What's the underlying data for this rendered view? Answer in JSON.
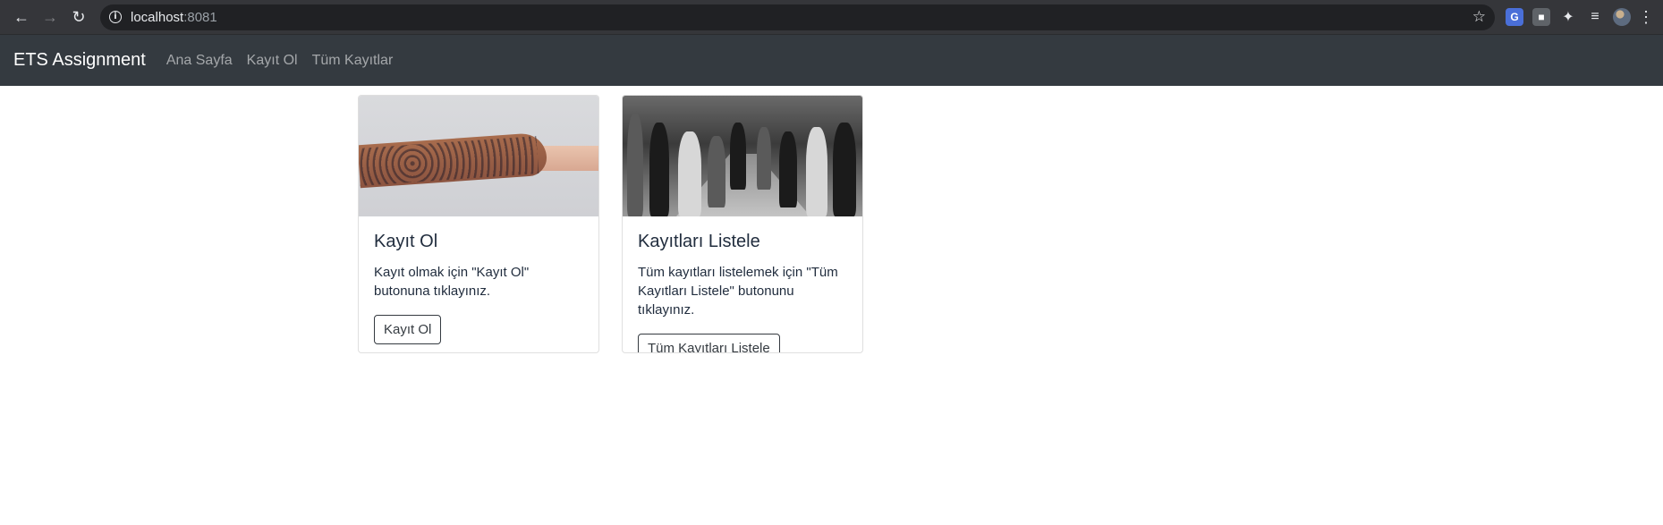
{
  "browser": {
    "url_host": "localhost",
    "url_port": ":8081"
  },
  "navbar": {
    "brand": "ETS Assignment",
    "links": [
      "Ana Sayfa",
      "Kayıt Ol",
      "Tüm Kayıtlar"
    ]
  },
  "cards": [
    {
      "title": "Kayıt Ol",
      "text": "Kayıt olmak için \"Kayıt Ol\" butonuna tıklayınız.",
      "button": "Kayıt Ol",
      "image": "hands-photo"
    },
    {
      "title": "Kayıtları Listele",
      "text": "Tüm kayıtları listelemek için \"Tüm Kayıtları Listele\" butonunu tıklayınız.",
      "button": "Tüm Kayıtları Listele",
      "image": "crowd-photo"
    }
  ],
  "colors": {
    "navbar_bg": "#343a40",
    "chrome_bg": "#35363a",
    "text": "#212d3e"
  }
}
